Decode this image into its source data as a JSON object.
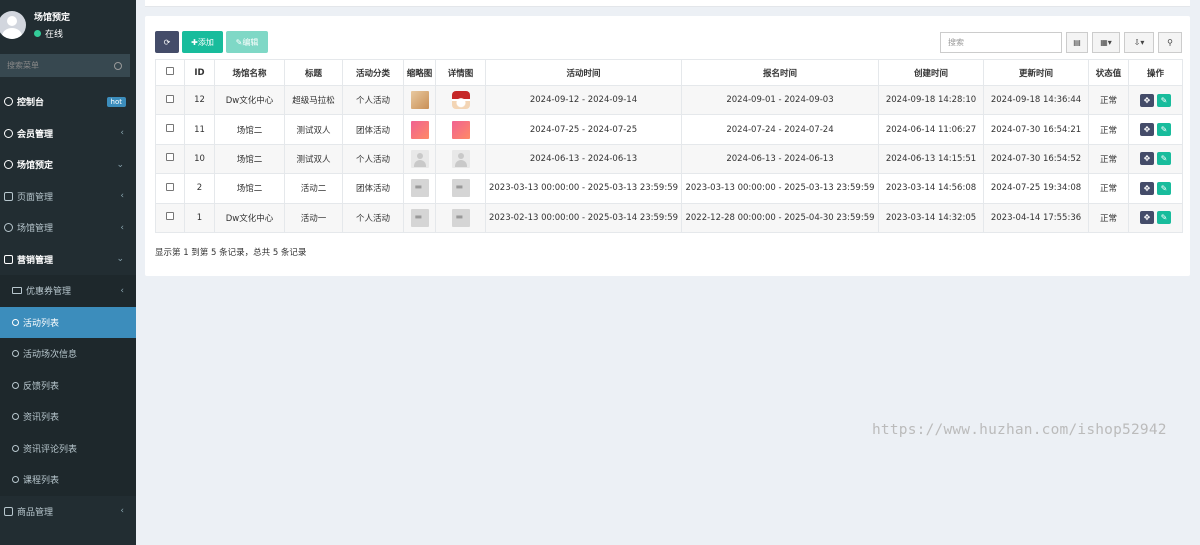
{
  "sidebar": {
    "user_name": "场馆预定",
    "user_status": "在线",
    "search_placeholder": "搜索菜单",
    "items": [
      {
        "label": "控制台",
        "icon": "dashboard-icon",
        "badge": "hot"
      },
      {
        "label": "会员管理",
        "icon": "user-icon"
      },
      {
        "label": "场馆预定",
        "icon": "venue-icon"
      },
      {
        "label": "页面管理",
        "icon": "bookmark-icon"
      },
      {
        "label": "场馆管理",
        "icon": "gear-icon"
      },
      {
        "label": "营销管理",
        "icon": "megaphone-icon"
      },
      {
        "label": "优惠券管理",
        "icon": "card-icon"
      },
      {
        "label": "活动列表",
        "icon": "circle-icon"
      },
      {
        "label": "活动场次信息",
        "icon": "circle-icon"
      },
      {
        "label": "反馈列表",
        "icon": "circle-icon"
      },
      {
        "label": "资讯列表",
        "icon": "circle-icon"
      },
      {
        "label": "资讯评论列表",
        "icon": "circle-icon"
      },
      {
        "label": "课程列表",
        "icon": "circle-icon"
      },
      {
        "label": "商品管理",
        "icon": "list-icon"
      }
    ]
  },
  "toolbar": {
    "add_label": "添加",
    "edit_label": "编辑",
    "search_placeholder": "搜索"
  },
  "table": {
    "headers": [
      "ID",
      "场馆名称",
      "标题",
      "活动分类",
      "缩略图",
      "详情图",
      "活动时间",
      "报名时间",
      "创建时间",
      "更新时间",
      "状态值",
      "操作"
    ],
    "rows": [
      {
        "id": "12",
        "venue": "Dw文化中心",
        "title": "超级马拉松",
        "category": "个人活动",
        "thumb": "food-image",
        "detail": "santa-image",
        "activity_time": "2024-09-12 - 2024-09-14",
        "signup_time": "2024-09-01 - 2024-09-03",
        "created": "2024-09-18 14:28:10",
        "updated": "2024-09-18 14:36:44",
        "status": "正常"
      },
      {
        "id": "11",
        "venue": "场馆二",
        "title": "测试双人",
        "category": "团体活动",
        "thumb": "pink-image",
        "detail": "pink-image",
        "activity_time": "2024-07-25 - 2024-07-25",
        "signup_time": "2024-07-24 - 2024-07-24",
        "created": "2024-06-14 11:06:27",
        "updated": "2024-07-30 16:54:21",
        "status": "正常"
      },
      {
        "id": "10",
        "venue": "场馆二",
        "title": "测试双人",
        "category": "个人活动",
        "thumb": "avatar-placeholder",
        "detail": "avatar-placeholder",
        "activity_time": "2024-06-13 - 2024-06-13",
        "signup_time": "2024-06-13 - 2024-06-13",
        "created": "2024-06-13 14:15:51",
        "updated": "2024-07-30 16:54:52",
        "status": "正常"
      },
      {
        "id": "2",
        "venue": "场馆二",
        "title": "活动二",
        "category": "团体活动",
        "thumb": "image-placeholder",
        "detail": "image-placeholder",
        "activity_time": "2023-03-13 00:00:00 - 2025-03-13 23:59:59",
        "signup_time": "2023-03-13 00:00:00 - 2025-03-13 23:59:59",
        "created": "2023-03-14 14:56:08",
        "updated": "2024-07-25 19:34:08",
        "status": "正常"
      },
      {
        "id": "1",
        "venue": "Dw文化中心",
        "title": "活动一",
        "category": "个人活动",
        "thumb": "image-placeholder",
        "detail": "image-placeholder",
        "activity_time": "2023-02-13 00:00:00 - 2025-03-14 23:59:59",
        "signup_time": "2022-12-28 00:00:00 - 2025-04-30 23:59:59",
        "created": "2023-03-14 14:32:05",
        "updated": "2023-04-14 17:55:36",
        "status": "正常"
      }
    ]
  },
  "pager_info": "显示第 1 到第 5 条记录，总共 5 条记录",
  "watermark": "https://www.huzhan.com/ishop52942",
  "colors": {
    "sidebar_bg": "#222d32",
    "accent": "#3c8dbc",
    "success": "#18bc9c",
    "primary_dark": "#444c69"
  }
}
